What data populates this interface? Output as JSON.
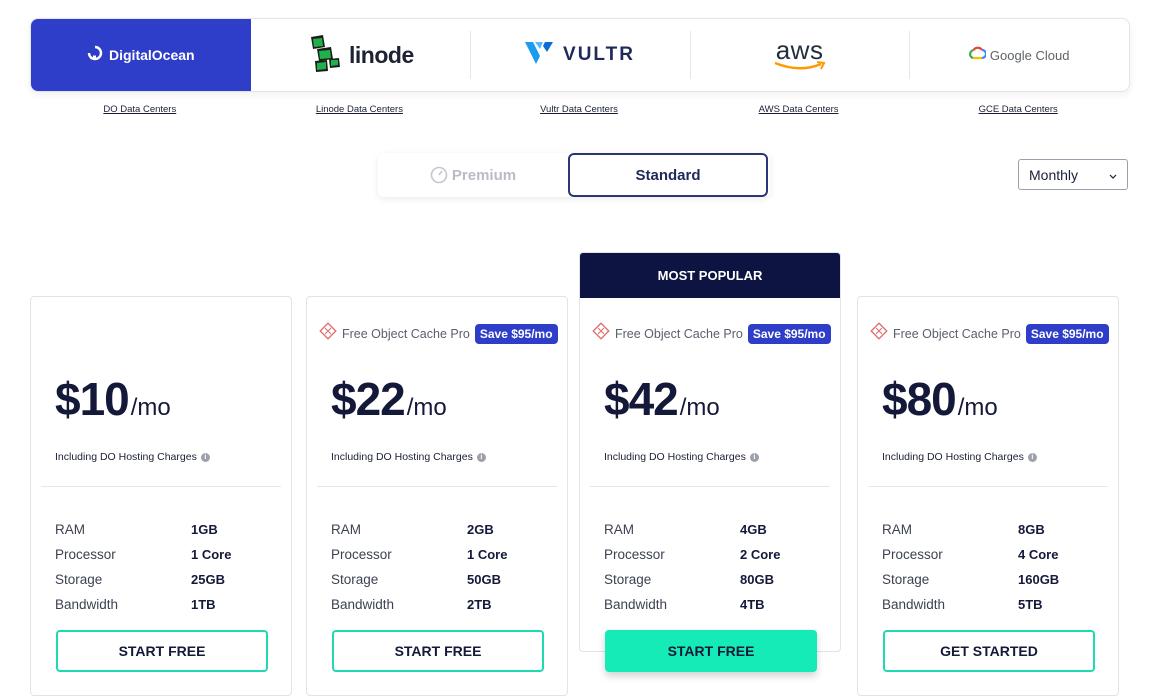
{
  "providers": [
    {
      "name": "DigitalOcean",
      "icon": "digitalocean-logo-icon",
      "link": "DO Data Centers",
      "active": true
    },
    {
      "name": "linode",
      "icon": "linode-logo-icon",
      "link": "Linode Data Centers",
      "active": false
    },
    {
      "name": "VULTR",
      "icon": "vultr-logo-icon",
      "link": "Vultr Data Centers",
      "active": false
    },
    {
      "name": "aws",
      "icon": "aws-logo-icon",
      "link": "AWS Data Centers",
      "active": false
    },
    {
      "name": "Google Cloud",
      "icon": "google-cloud-logo-icon",
      "link": "GCE Data Centers",
      "active": false
    }
  ],
  "tiers": {
    "premium": "Premium",
    "standard": "Standard",
    "selected": "Standard"
  },
  "billing": {
    "selected": "Monthly"
  },
  "colors": {
    "accent": "#2f3ec9",
    "cta": "#14ebb6",
    "ribbon": "#0e1442"
  },
  "plans": [
    {
      "price": "$10",
      "unit": "/mo",
      "note": "Including DO Hosting Charges",
      "promo": null,
      "badge": null,
      "specs": [
        {
          "label": "RAM",
          "value": "1GB"
        },
        {
          "label": "Processor",
          "value": "1 Core"
        },
        {
          "label": "Storage",
          "value": "25GB"
        },
        {
          "label": "Bandwidth",
          "value": "1TB"
        }
      ],
      "cta": "START FREE"
    },
    {
      "price": "$22",
      "unit": "/mo",
      "note": "Including DO Hosting Charges",
      "promo": "Free Object Cache Pro",
      "badge": "Save $95/mo",
      "specs": [
        {
          "label": "RAM",
          "value": "2GB"
        },
        {
          "label": "Processor",
          "value": "1 Core"
        },
        {
          "label": "Storage",
          "value": "50GB"
        },
        {
          "label": "Bandwidth",
          "value": "2TB"
        }
      ],
      "cta": "START FREE"
    },
    {
      "price": "$42",
      "unit": "/mo",
      "note": "Including DO Hosting Charges",
      "promo": "Free Object Cache Pro",
      "badge": "Save $95/mo",
      "ribbon": "MOST POPULAR",
      "specs": [
        {
          "label": "RAM",
          "value": "4GB"
        },
        {
          "label": "Processor",
          "value": "2 Core"
        },
        {
          "label": "Storage",
          "value": "80GB"
        },
        {
          "label": "Bandwidth",
          "value": "4TB"
        }
      ],
      "cta": "START FREE"
    },
    {
      "price": "$80",
      "unit": "/mo",
      "note": "Including DO Hosting Charges",
      "promo": "Free Object Cache Pro",
      "badge": "Save $95/mo",
      "specs": [
        {
          "label": "RAM",
          "value": "8GB"
        },
        {
          "label": "Processor",
          "value": "4 Core"
        },
        {
          "label": "Storage",
          "value": "160GB"
        },
        {
          "label": "Bandwidth",
          "value": "5TB"
        }
      ],
      "cta": "GET STARTED"
    }
  ]
}
